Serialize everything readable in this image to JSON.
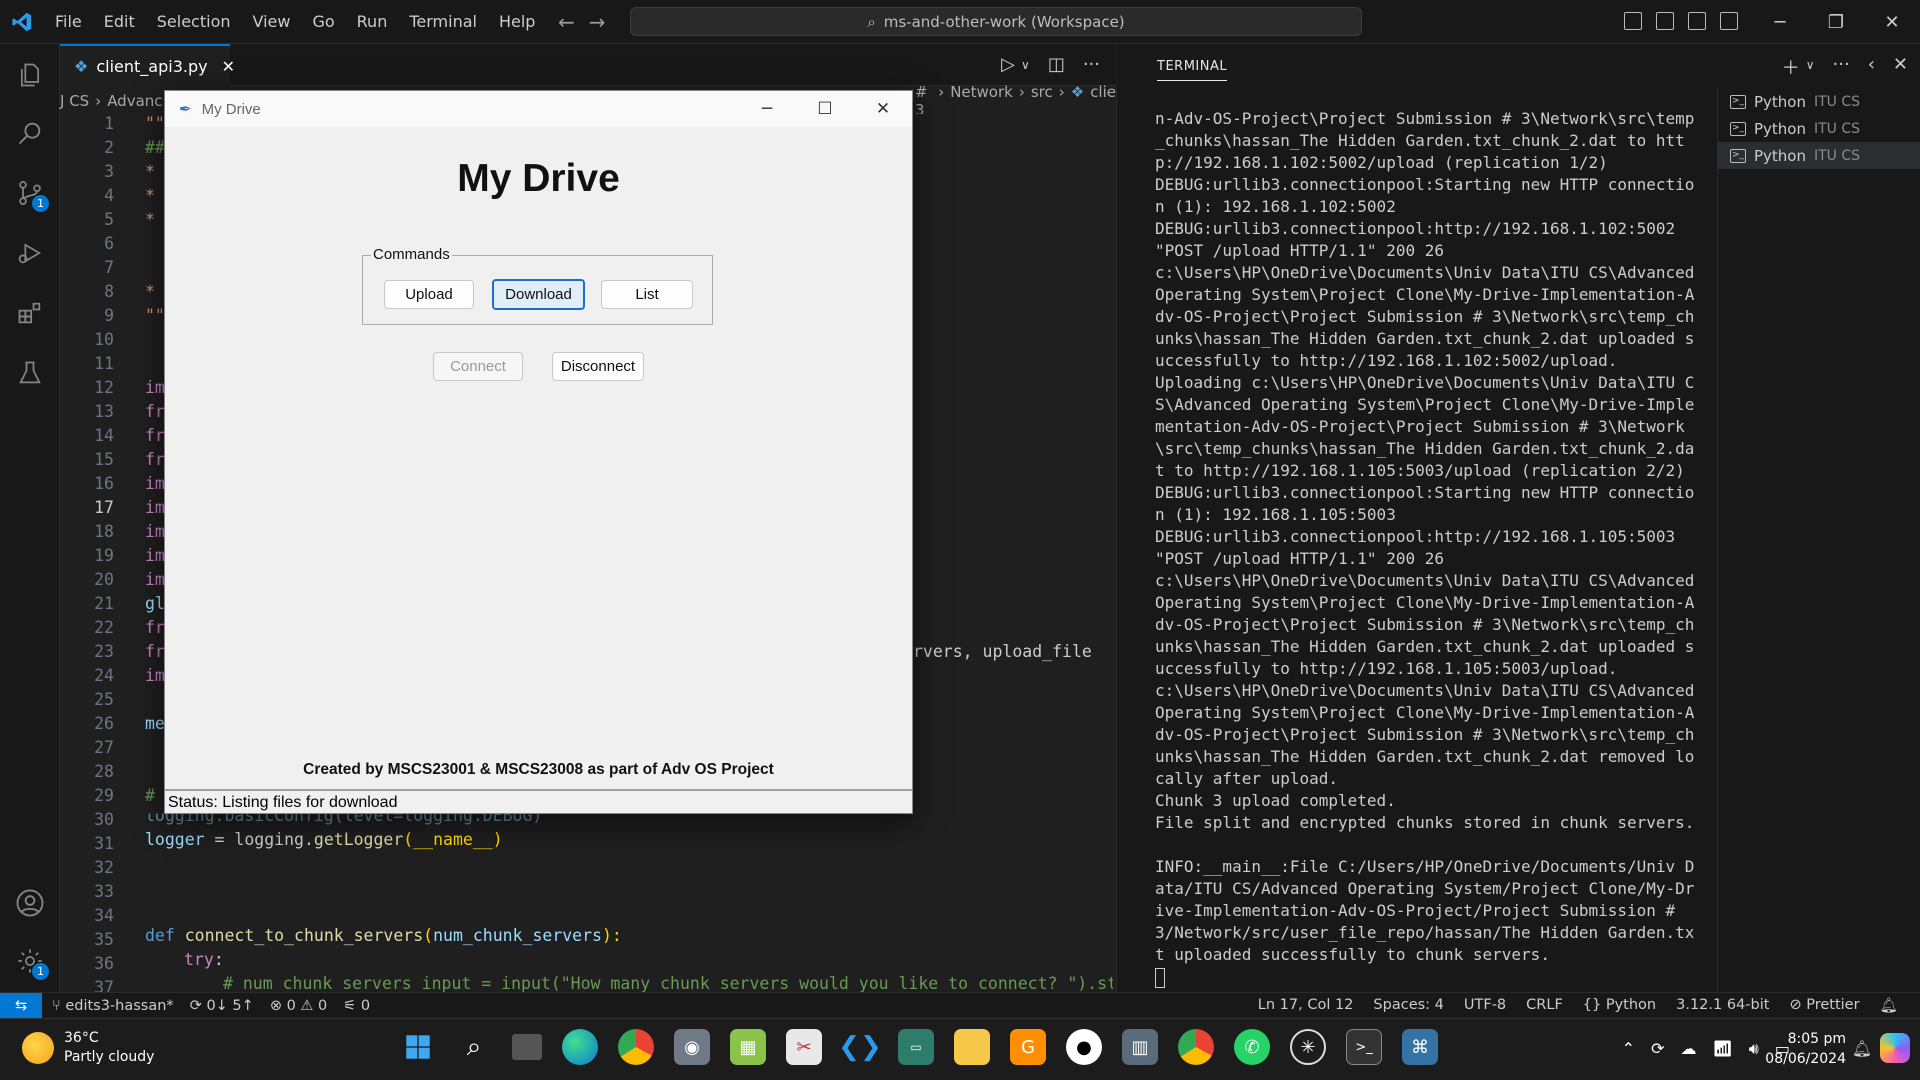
{
  "menu": [
    "File",
    "Edit",
    "Selection",
    "View",
    "Go",
    "Run",
    "Terminal",
    "Help"
  ],
  "command_center": "ms-and-other-work (Workspace)",
  "tab": {
    "label": "client_api3.py"
  },
  "breadcrumb": {
    "left": "J CS",
    "left2": "Advanc",
    "right": [
      "# 3",
      "Network",
      "src",
      "clie"
    ]
  },
  "line_numbers": [
    "1",
    "2",
    "3",
    "4",
    "5",
    "6",
    "7",
    "8",
    "9",
    "10",
    "11",
    "12",
    "13",
    "14",
    "15",
    "16",
    "17",
    "18",
    "19",
    "20",
    "21",
    "22",
    "23",
    "24",
    "25",
    "26",
    "27",
    "28",
    "29",
    "30",
    "31",
    "32",
    "33",
    "34",
    "35",
    "36",
    "37"
  ],
  "code_partial": {
    "l1": "\"\"",
    "l2": "##",
    "l3": "*",
    "l4": "*",
    "l5": "*",
    "l8": "*",
    "l9": "\"\"",
    "l12": "im",
    "l13": "fr",
    "l14": "fr",
    "l15": "fr",
    "l16": "im",
    "l17": "im",
    "l18": "im",
    "l19": "im",
    "l20": "im",
    "l21": "gl",
    "l22": "fr",
    "l23": "fr",
    "l23r": "rvers, upload_file",
    "l24": "im",
    "l26": "me",
    "l29": "#",
    "l30": "logging.basicConfig(level=logging.DEBUG)"
  },
  "code_full": {
    "l31a": "logger",
    "l31b": " = logging.",
    "l31c": "getLogger",
    "l31d": "(__name__)",
    "l35a": "def ",
    "l35b": "connect_to_chunk_servers",
    "l35c": "(",
    "l35d": "num_chunk_servers",
    "l35e": "):",
    "l36": "try",
    "l37": "# num_chunk_servers_input = input(\"How many chunk servers would you like to connect? \").strip("
  },
  "panel": {
    "title": "TERMINAL"
  },
  "terminal_lines": "n-Adv-OS-Project\\Project Submission # 3\\Network\\src\\temp_chunks\\hassan_The Hidden Garden.txt_chunk_2.dat to http://192.168.1.102:5002/upload (replication 1/2)\nDEBUG:urllib3.connectionpool:Starting new HTTP connection (1): 192.168.1.102:5002\nDEBUG:urllib3.connectionpool:http://192.168.1.102:5002 \"POST /upload HTTP/1.1\" 200 26\nc:\\Users\\HP\\OneDrive\\Documents\\Univ Data\\ITU CS\\Advanced Operating System\\Project Clone\\My-Drive-Implementation-Adv-OS-Project\\Project Submission # 3\\Network\\src\\temp_chunks\\hassan_The Hidden Garden.txt_chunk_2.dat uploaded successfully to http://192.168.1.102:5002/upload.\nUploading c:\\Users\\HP\\OneDrive\\Documents\\Univ Data\\ITU CS\\Advanced Operating System\\Project Clone\\My-Drive-Implementation-Adv-OS-Project\\Project Submission # 3\\Network\\src\\temp_chunks\\hassan_The Hidden Garden.txt_chunk_2.dat to http://192.168.1.105:5003/upload (replication 2/2)\nDEBUG:urllib3.connectionpool:Starting new HTTP connection (1): 192.168.1.105:5003\nDEBUG:urllib3.connectionpool:http://192.168.1.105:5003 \"POST /upload HTTP/1.1\" 200 26\nc:\\Users\\HP\\OneDrive\\Documents\\Univ Data\\ITU CS\\Advanced Operating System\\Project Clone\\My-Drive-Implementation-Adv-OS-Project\\Project Submission # 3\\Network\\src\\temp_chunks\\hassan_The Hidden Garden.txt_chunk_2.dat uploaded successfully to http://192.168.1.105:5003/upload.\nc:\\Users\\HP\\OneDrive\\Documents\\Univ Data\\ITU CS\\Advanced Operating System\\Project Clone\\My-Drive-Implementation-Adv-OS-Project\\Project Submission # 3\\Network\\src\\temp_chunks\\hassan_The Hidden Garden.txt_chunk_2.dat removed locally after upload.\nChunk 3 upload completed.\nFile split and encrypted chunks stored in chunk servers.\n\nINFO:__main__:File C:/Users/HP/OneDrive/Documents/Univ Data/ITU CS/Advanced Operating System/Project Clone/My-Drive-Implementation-Adv-OS-Project/Project Submission # 3/Network/src/user_file_repo/hassan/The Hidden Garden.txt uploaded successfully to chunk servers.",
  "terminal_tabs": [
    {
      "name": "Python",
      "sub": "ITU CS"
    },
    {
      "name": "Python",
      "sub": "ITU CS"
    },
    {
      "name": "Python",
      "sub": "ITU CS"
    }
  ],
  "statusbar": {
    "branch": "edits3-hassan*",
    "sync": "0↓ 5↑",
    "problems": "⊗ 0 ⚠ 0",
    "ports": "0",
    "position": "Ln 17, Col 12",
    "spaces": "Spaces: 4",
    "encoding": "UTF-8",
    "eol": "CRLF",
    "language": "Python",
    "interpreter": "3.12.1 64-bit",
    "prettier": "Prettier"
  },
  "taskbar": {
    "temp": "36°C",
    "weather": "Partly cloudy",
    "time": "8:05 pm",
    "date": "08/06/2024"
  },
  "badges": {
    "scm": "1",
    "settings": "1"
  },
  "app": {
    "title": "My Drive",
    "heading": "My Drive",
    "group": "Commands",
    "buttons": {
      "upload": "Upload",
      "download": "Download",
      "list": "List",
      "connect": "Connect",
      "disconnect": "Disconnect"
    },
    "credit": "Created by MSCS23001 & MSCS23008 as part of Adv OS Project",
    "status": "Status: Listing files for download"
  },
  "colors": {
    "accent": "#0078d4",
    "editor_bg": "#1f1f1f",
    "panel_bg": "#181818"
  }
}
